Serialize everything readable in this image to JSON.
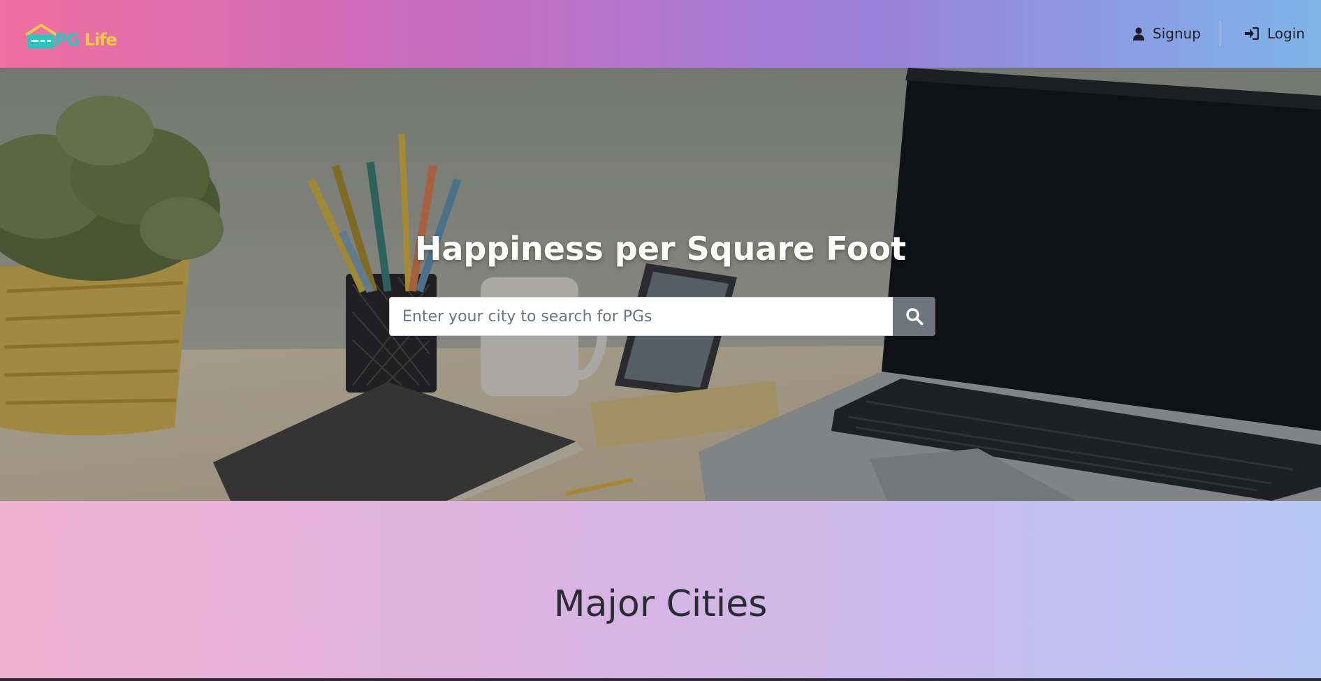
{
  "brand": {
    "part1": "PG",
    "part2": "Life",
    "logo_icon": "house-icon"
  },
  "nav": {
    "signup": {
      "label": "Signup",
      "icon": "user-icon"
    },
    "login": {
      "label": "Login",
      "icon": "sign-in-icon"
    }
  },
  "hero": {
    "title": "Happiness per Square Foot",
    "search": {
      "placeholder": "Enter your city to search for PGs",
      "value": "",
      "button_icon": "search-icon"
    }
  },
  "cities": {
    "title": "Major Cities"
  },
  "colors": {
    "brand_teal": "#2ec4c0",
    "brand_yellow": "#f7c948",
    "nav_gradient_start": "#f06ea0",
    "nav_gradient_end": "#7fb4e9",
    "search_button": "#6c757d"
  }
}
